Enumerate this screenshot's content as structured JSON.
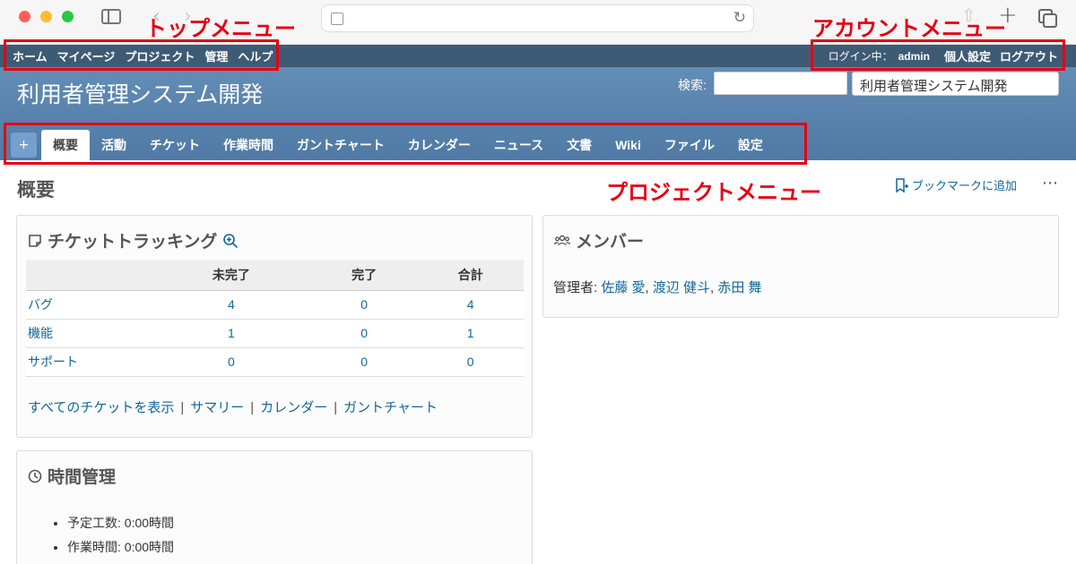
{
  "top_menu": {
    "items": [
      "ホーム",
      "マイページ",
      "プロジェクト",
      "管理",
      "ヘルプ"
    ]
  },
  "account_menu": {
    "logged_in_label": "ログイン中：",
    "user": "admin",
    "items": [
      "個人設定",
      "ログアウト"
    ]
  },
  "header": {
    "project_title": "利用者管理システム開発",
    "search_label": "検索:",
    "search_value": "",
    "project_select_value": "利用者管理システム開発"
  },
  "project_menu": {
    "new_button": "+",
    "tabs": [
      "概要",
      "活動",
      "チケット",
      "作業時間",
      "ガントチャート",
      "カレンダー",
      "ニュース",
      "文書",
      "Wiki",
      "ファイル",
      "設定"
    ],
    "selected": "概要"
  },
  "annotations": {
    "top_menu": "トップメニュー",
    "account_menu": "アカウントメニュー",
    "project_menu": "プロジェクトメニュー"
  },
  "main": {
    "heading": "概要",
    "bookmark_label": "ブックマークに追加",
    "more": "⋯"
  },
  "issue_tracking": {
    "title": "チケットトラッキング",
    "columns": [
      "",
      "未完了",
      "完了",
      "合計"
    ],
    "rows": [
      {
        "name": "バグ",
        "open": "4",
        "closed": "0",
        "total": "4"
      },
      {
        "name": "機能",
        "open": "1",
        "closed": "0",
        "total": "1"
      },
      {
        "name": "サポート",
        "open": "0",
        "closed": "0",
        "total": "0"
      }
    ],
    "links": [
      "すべてのチケットを表示",
      "サマリー",
      "カレンダー",
      "ガントチャート"
    ],
    "separator": "|"
  },
  "members": {
    "title": "メンバー",
    "role_label": "管理者: ",
    "names": [
      "佐藤 愛",
      "渡辺 健斗",
      "赤田 舞"
    ],
    "name_separator": ", "
  },
  "time_tracking": {
    "title": "時間管理",
    "items": [
      "予定工数: 0:00時間",
      "作業時間: 0:00時間"
    ]
  },
  "colors": {
    "top_menu_bg": "#3e5b76",
    "header_bg": "#628db5",
    "link": "#116699",
    "annotation": "#e60012"
  }
}
